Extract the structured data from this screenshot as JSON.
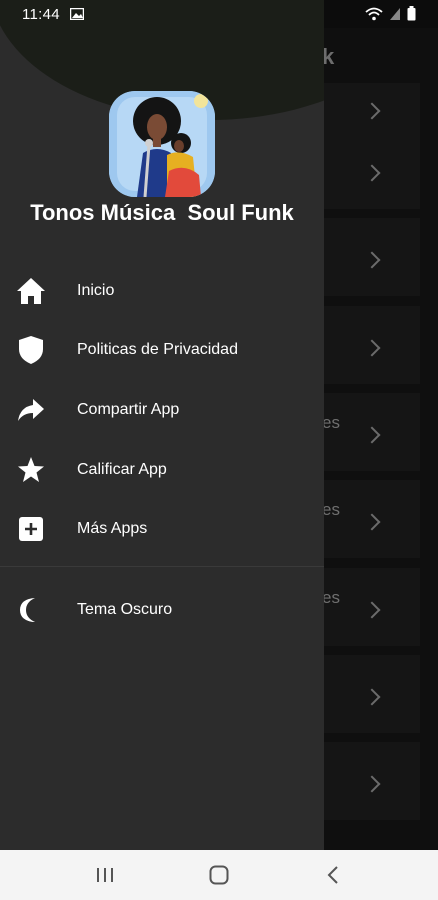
{
  "status_bar": {
    "time": "11:44"
  },
  "background": {
    "title_fragment": "k",
    "row_text_fragments": [
      "es",
      "es",
      "es"
    ]
  },
  "drawer": {
    "app_title": "Tonos Música  Soul Funk",
    "menu": [
      {
        "label": "Inicio",
        "icon": "home-icon"
      },
      {
        "label": "Politicas de Privacidad",
        "icon": "shield-icon"
      },
      {
        "label": "Compartir App",
        "icon": "share-icon"
      },
      {
        "label": "Calificar App",
        "icon": "star-icon"
      },
      {
        "label": "Más Apps",
        "icon": "plus-box-icon"
      }
    ],
    "theme": {
      "label": "Tema Oscuro",
      "icon": "moon-icon",
      "enabled": true
    }
  },
  "colors": {
    "drawer_bg": "#2c2c2c",
    "accent": "#1f5a1f"
  }
}
